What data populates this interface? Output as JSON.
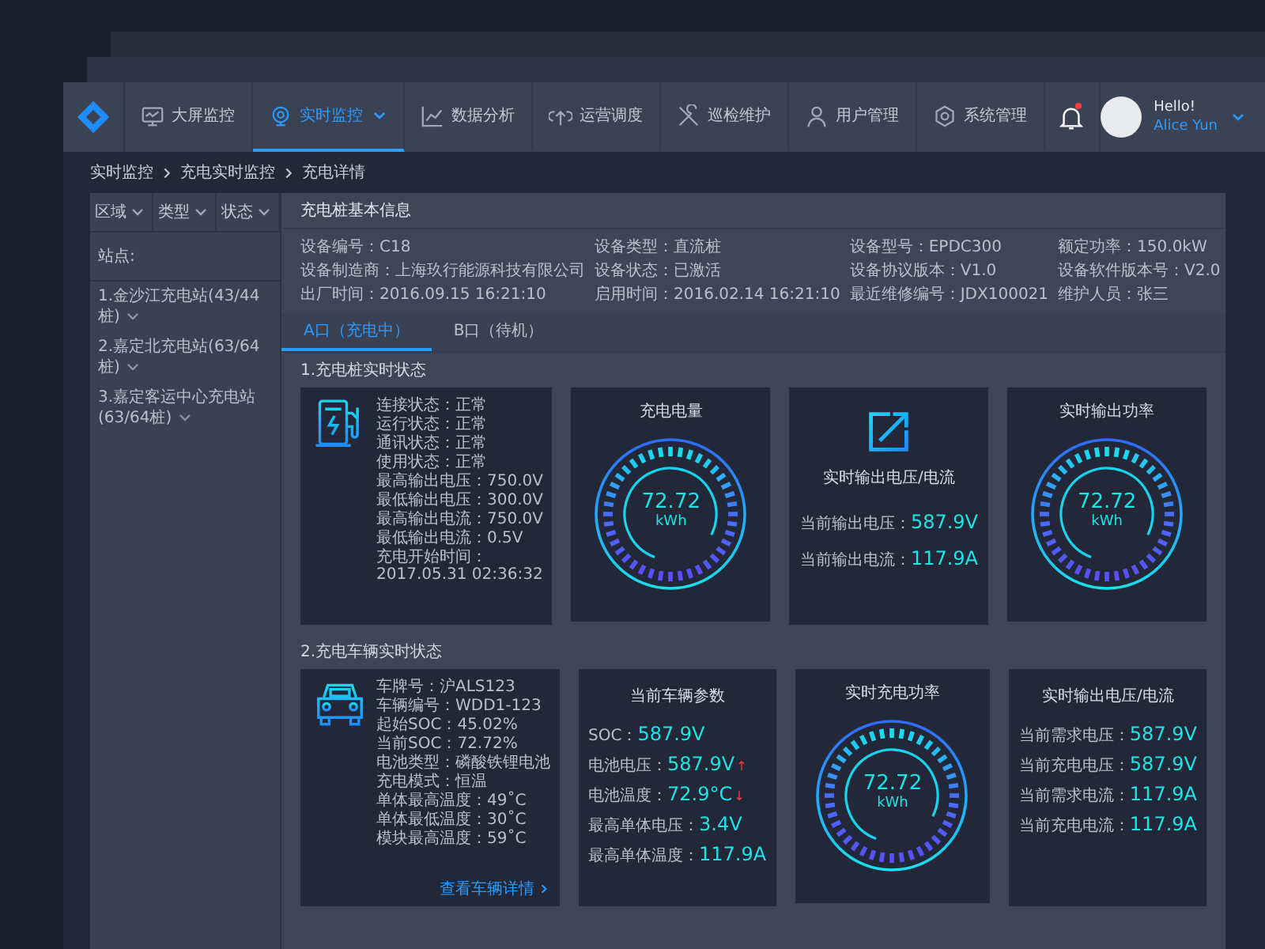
{
  "nav": {
    "items": [
      {
        "label": "大屏监控",
        "selected": false,
        "dropdown": false
      },
      {
        "label": "实时监控",
        "selected": true,
        "dropdown": true
      },
      {
        "label": "数据分析",
        "selected": false,
        "dropdown": false
      },
      {
        "label": "运营调度",
        "selected": false,
        "dropdown": false
      },
      {
        "label": "巡检维护",
        "selected": false,
        "dropdown": false
      },
      {
        "label": "用户管理",
        "selected": false,
        "dropdown": false
      },
      {
        "label": "系统管理",
        "selected": false,
        "dropdown": false
      }
    ],
    "notifications": {
      "unread": true
    },
    "user": {
      "greeting": "Hello!",
      "name": "Alice Yun"
    }
  },
  "breadcrumb": [
    "实时监控",
    "充电实时监控",
    "充电详情"
  ],
  "sidebar": {
    "filters": [
      "区域",
      "类型",
      "状态"
    ],
    "stations_label": "站点:",
    "stations": [
      "1.金沙江充电站(43/44桩)",
      "2.嘉定北充电站(63/64桩)",
      "3.嘉定客运中心充电站(63/64桩)"
    ]
  },
  "basic_info": {
    "title": "充电桩基本信息",
    "fields": [
      "设备编号：C18",
      "设备类型：直流桩",
      "设备型号：EPDC300",
      "额定功率：150.0kW",
      "设备制造商：上海玖行能源科技有限公司",
      "设备状态：已激活",
      "设备协议版本：V1.0",
      "设备软件版本号：V2.0",
      "出厂时间：2016.09.15 16:21:10",
      "启用时间：2016.02.14 16:21:10",
      "最近维修编号：JDX100021",
      "维护人员：张三"
    ]
  },
  "ports": [
    {
      "label": "A口（充电中）",
      "selected": true
    },
    {
      "label": "B口（待机）",
      "selected": false
    }
  ],
  "pile_status": {
    "title": "1.充电桩实时状态",
    "lines": [
      "连接状态：正常",
      "运行状态：正常",
      "通讯状态：正常",
      "使用状态：正常",
      "最高输出电压：750.0V",
      "最低输出电压：300.0V",
      "最高输出电流：750.0V",
      "最低输出电流：0.5V"
    ],
    "start_time_label": "充电开始时间：",
    "start_time": "2017.05.31 02:36:32",
    "energy": {
      "title": "充电电量",
      "value": "72.72",
      "unit": "kWh"
    },
    "output": {
      "title": "实时输出电压/电流",
      "rows": [
        {
          "label": "当前输出电压：",
          "value": "587.9V"
        },
        {
          "label": "当前输出电流：",
          "value": "117.9A"
        }
      ]
    },
    "power": {
      "title": "实时输出功率",
      "value": "72.72",
      "unit": "kWh"
    }
  },
  "vehicle_status": {
    "title": "2.充电车辆实时状态",
    "lines": [
      "车牌号：沪ALS123",
      "车辆编号：WDD1-123",
      "起始SOC：45.02%",
      "当前SOC：72.72%",
      "电池类型：磷酸铁锂电池",
      "充电模式：恒温",
      "单体最高温度：49˚C",
      "单体最低温度：30˚C",
      "模块最高温度：59˚C"
    ],
    "detail_link": "查看车辆详情",
    "params": {
      "title": "当前车辆参数",
      "rows": [
        {
          "label": "SOC：",
          "value": "587.9V"
        },
        {
          "label": "电池电压：",
          "value": "587.9V",
          "trend": "↑"
        },
        {
          "label": "电池温度：",
          "value": "72.9°C",
          "trend": "↓"
        },
        {
          "label": "最高单体电压：",
          "value": "3.4V"
        },
        {
          "label": "最高单体温度：",
          "value": "117.9A"
        }
      ]
    },
    "charge_power": {
      "title": "实时充电功率",
      "value": "72.72",
      "unit": "kWh"
    },
    "output": {
      "title": "实时输出电压/电流",
      "rows": [
        {
          "label": "当前需求电压：",
          "value": "587.9V"
        },
        {
          "label": "当前充电电压：",
          "value": "587.9V"
        },
        {
          "label": "当前需求电流：",
          "value": "117.9A"
        },
        {
          "label": "当前充电电流：",
          "value": "117.9A"
        }
      ]
    }
  }
}
